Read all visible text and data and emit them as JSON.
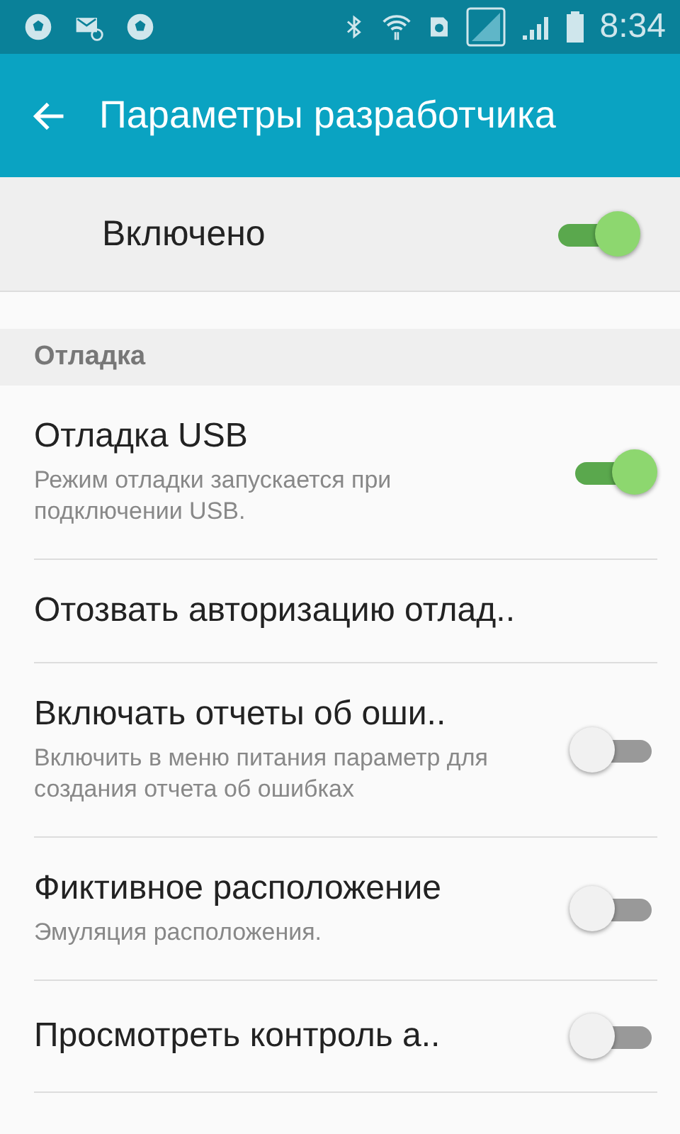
{
  "status_bar": {
    "time": "8:34"
  },
  "app_bar": {
    "title": "Параметры разработчика"
  },
  "master_switch": {
    "label": "Включено",
    "on": true
  },
  "category": {
    "title": "Отладка"
  },
  "items": [
    {
      "kind": "switch",
      "title": "Отладка USB",
      "summary": "Режим отладки запускается при подключении USB.",
      "on": true
    },
    {
      "kind": "plain",
      "title": "Отозвать авторизацию отлад.."
    },
    {
      "kind": "switch",
      "title": "Включать отчеты об оши..",
      "summary": "Включить в меню питания параметр для создания отчета об ошибках",
      "on": false
    },
    {
      "kind": "switch",
      "title": "Фиктивное расположение",
      "summary": "Эмуляция расположения.",
      "on": false
    },
    {
      "kind": "switch",
      "title": "Просмотреть контроль а..",
      "on": false
    }
  ]
}
